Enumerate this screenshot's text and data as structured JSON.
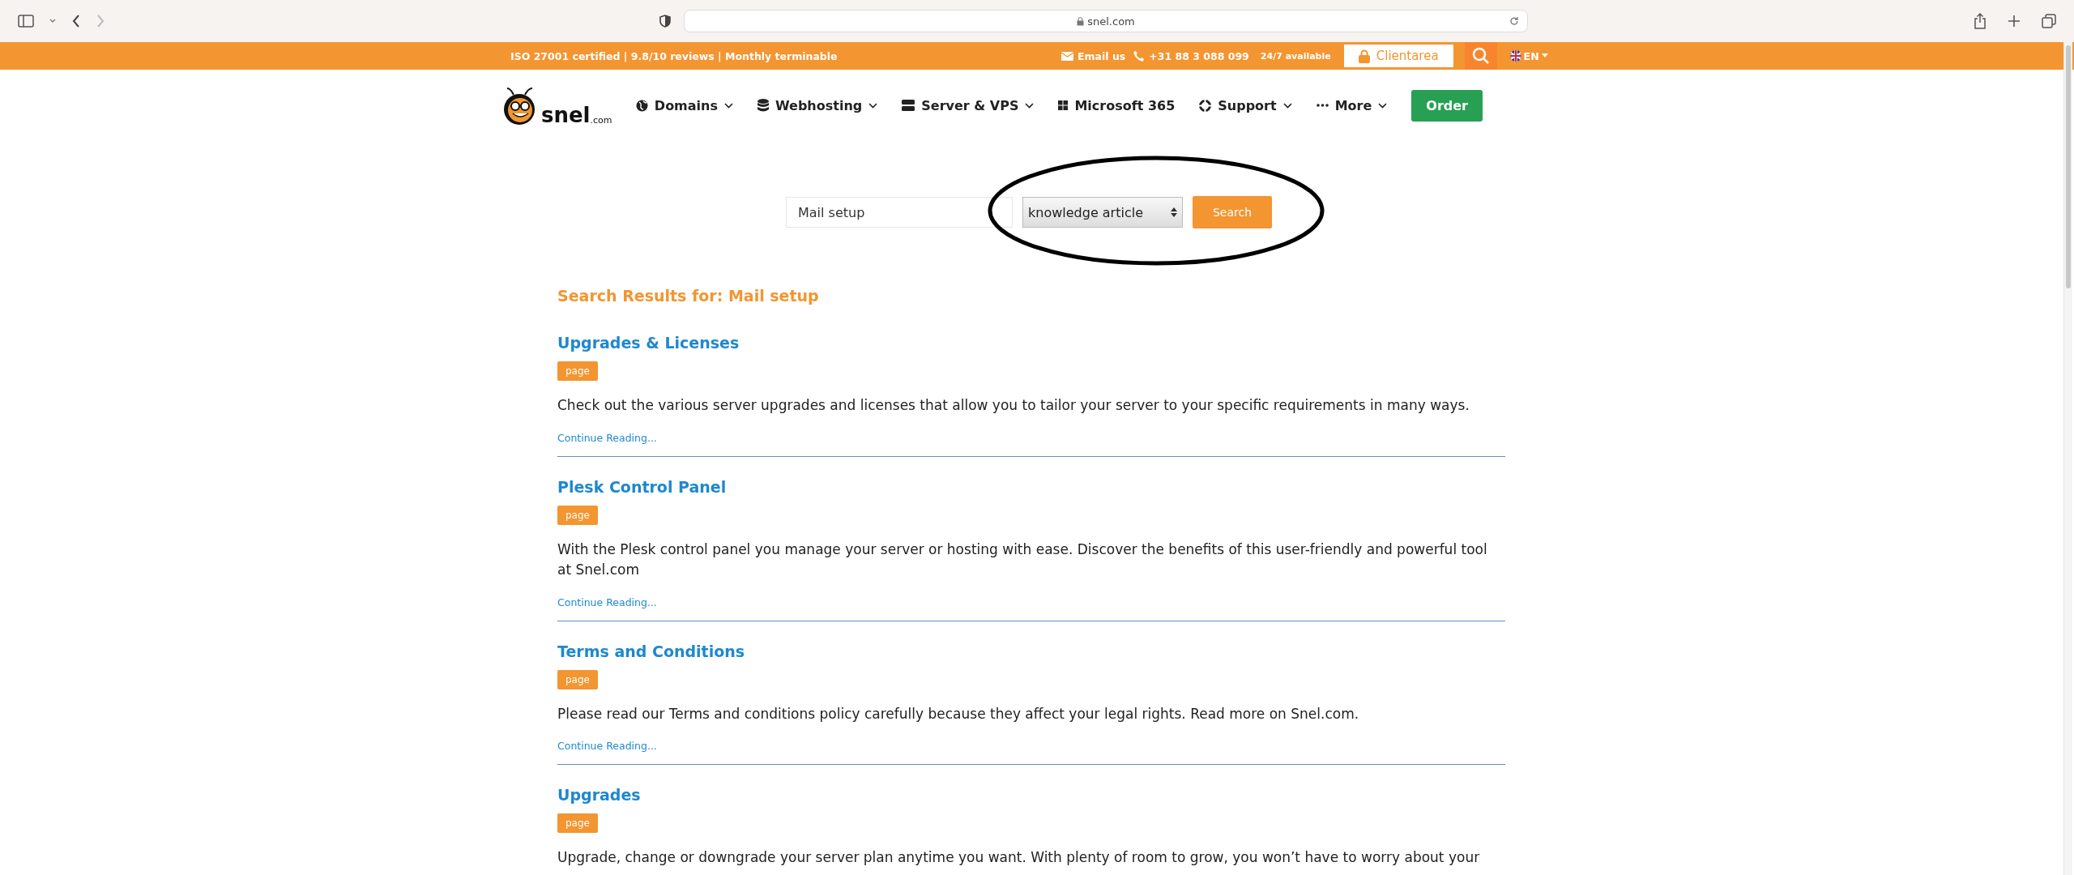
{
  "browser": {
    "url": "snel.com"
  },
  "topbar": {
    "tagline": "ISO 27001 certified | 9.8/10 reviews | Monthly terminable",
    "email": "Email us",
    "phone": "+31 88 3 088 099",
    "availability": "24/7 available",
    "client_area": "Clientarea",
    "language": "EN"
  },
  "nav": {
    "logo": "snel",
    "logo_suffix": ".com",
    "items": [
      {
        "label": "Domains",
        "dropdown": true
      },
      {
        "label": "Webhosting",
        "dropdown": true
      },
      {
        "label": "Server & VPS",
        "dropdown": true
      },
      {
        "label": "Microsoft 365",
        "dropdown": false
      },
      {
        "label": "Support",
        "dropdown": true
      },
      {
        "label": "More",
        "dropdown": true
      }
    ],
    "order": "Order"
  },
  "search": {
    "value": "Mail setup",
    "type": "knowledge article",
    "button": "Search",
    "highlighted": true
  },
  "results": {
    "heading": "Search Results for: Mail setup",
    "items": [
      {
        "title": "Upgrades & Licenses",
        "tag": "page",
        "description": "Check out the various server upgrades and licenses that allow you to tailor your server to your specific requirements in many ways.",
        "link": "Continue Reading..."
      },
      {
        "title": "Plesk Control Panel",
        "tag": "page",
        "description": "With the Plesk control panel you manage your server or hosting with ease. Discover the benefits of this user-friendly and powerful tool at Snel.com",
        "link": "Continue Reading..."
      },
      {
        "title": "Terms and Conditions",
        "tag": "page",
        "description": "Please read our Terms and conditions policy carefully because they affect your legal rights. Read more on Snel.com.",
        "link": "Continue Reading..."
      },
      {
        "title": "Upgrades",
        "tag": "page",
        "description": "Upgrade, change or downgrade your server plan anytime you want. With plenty of room to grow, you won’t have to worry about your"
      }
    ]
  }
}
